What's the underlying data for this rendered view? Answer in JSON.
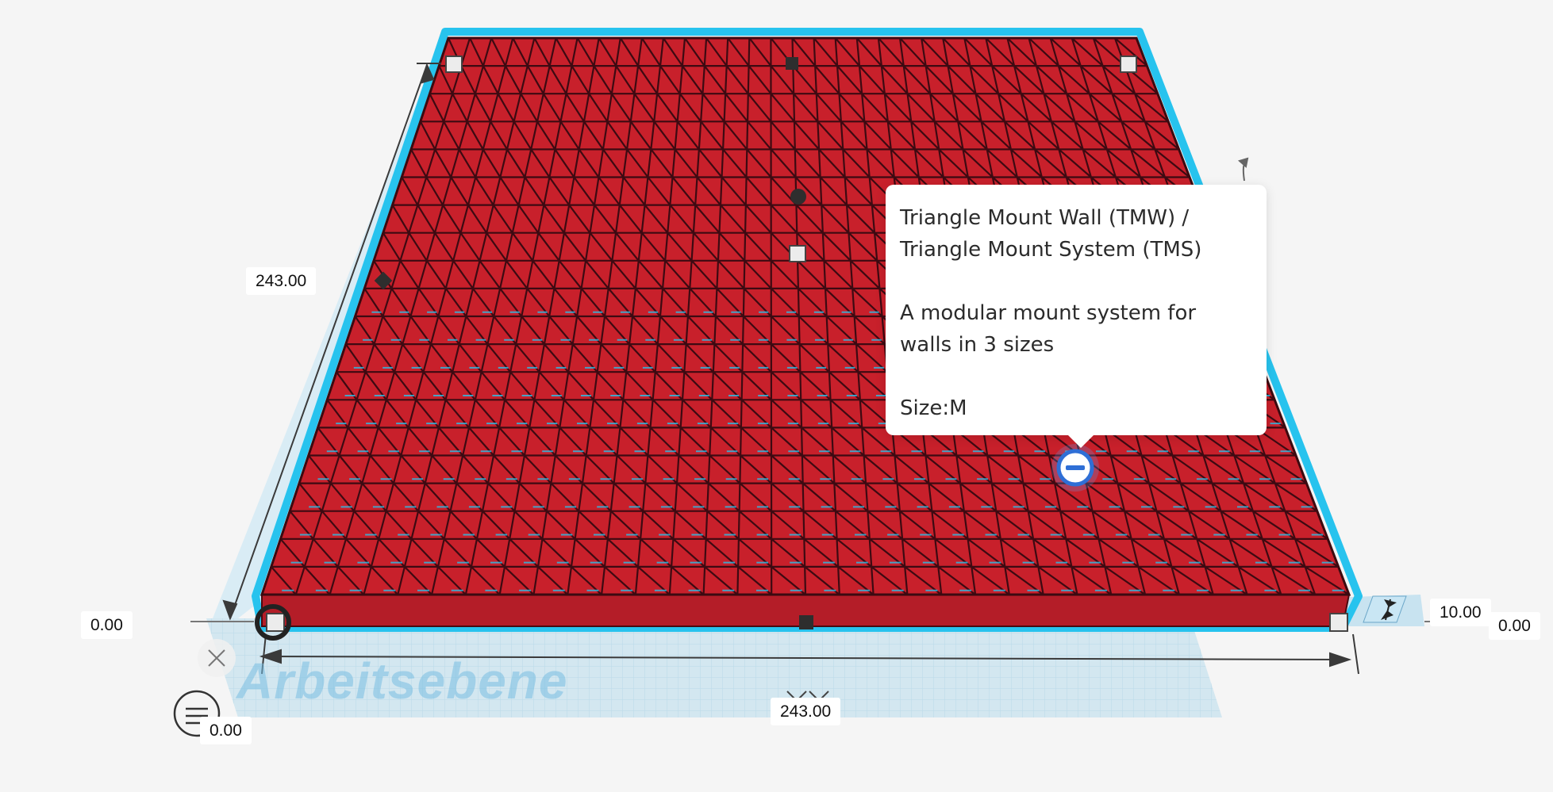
{
  "object": {
    "name": "Triangle Mount Wall (TMW) / Triangle Mount System (TMS)",
    "color": "#c8202b",
    "selection_color": "#27c3ee"
  },
  "tooltip": {
    "title_line1": "Triangle Mount Wall (TMW) /",
    "title_line2": "Triangle Mount System (TMS)",
    "desc_line1": "A modular mount system for",
    "desc_line2": "walls in 3 sizes",
    "size": "Size:M"
  },
  "dimensions": {
    "depth": "243.00",
    "width": "243.00",
    "height": "10.00",
    "left_offset": "0.00",
    "right_offset": "0.00",
    "front_offset": "0.00"
  },
  "workplane": {
    "label": "Arbeitsebene"
  },
  "icons": {
    "rotate": "rotate-arrow-icon",
    "close": "close-icon",
    "snap": "snap-grid-icon",
    "drop": "drop-to-workplane-icon",
    "height_arrow": "height-arrow-icon"
  }
}
